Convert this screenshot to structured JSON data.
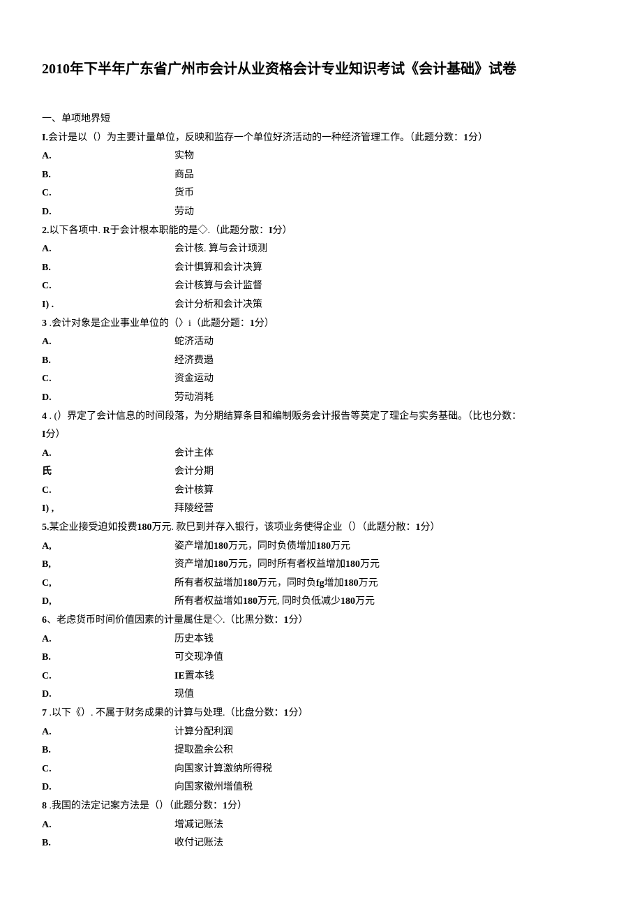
{
  "title": "2010年下半年广东省广州市会计从业资格会计专业知识考试《会计基础》试卷",
  "section1": "一、单项地界短",
  "questions": [
    {
      "num": "I.",
      "stem": "会计是以（）为主要计量单位，反映和监存一个单位好济活动的一种经济管理工作。（此题分数：",
      "tail": "分）",
      "tailnum": "1",
      "opts": [
        {
          "l": "A.",
          "t": "实物"
        },
        {
          "l": "B.",
          "t": "商品"
        },
        {
          "l": "C.",
          "t": "货币"
        },
        {
          "l": "D.",
          "t": "劳动"
        }
      ]
    },
    {
      "num": "2.",
      "stem": "以下各项中. ",
      "stembold": "R",
      "stem2": "于会计根本职能的是◇.（此题分散：",
      "tailnum": "I",
      "tail": "分）",
      "opts": [
        {
          "l": "A.",
          "t": "会计核. 算与会计顼测"
        },
        {
          "l": "B.",
          "t": "会计惧算和会计决算"
        },
        {
          "l": "C.",
          "t": "会计核算与会计监督"
        },
        {
          "l": "I) .",
          "t": "会计分析和会计决策"
        }
      ]
    },
    {
      "num": "3",
      "numsp": "   .",
      "stem": "会计对象是企业事业单位的（〉i（此题分题：",
      "tailnum": "1",
      "tail": "分）",
      "opts": [
        {
          "l": "A.",
          "t": "蛇济活动"
        },
        {
          "l": "B.",
          "t": "经济费遢"
        },
        {
          "l": "C.",
          "t": "资金运动"
        },
        {
          "l": "D.",
          "t": "劳动消耗"
        }
      ]
    },
    {
      "num": "4",
      "numsp": "   .  (",
      "stem": "）界定了会计信息的时间段落，为分期结算条目和编制贩务会计报告等莫定了理企与实务基础。（比也分数：",
      "tailnum": "I",
      "tail": "分）",
      "wrap": true,
      "opts": [
        {
          "l": "A.",
          "t": "会计主体"
        },
        {
          "l": "氏",
          "t": "会计分期"
        },
        {
          "l": "C.",
          "t": "会计核算"
        },
        {
          "l": "I) ,",
          "t": "拜陵经营"
        }
      ]
    },
    {
      "num": "5.",
      "stem": "某企业接受迫如投费",
      "stembold": "180",
      "stem2": "万元. 款巳到并存入银行，该项业务使得企业（）（此题分敝：",
      "tailnum": "1",
      "tail": "分）",
      "opts": [
        {
          "l": "A,",
          "t": "姿产增加",
          "t1b": "180",
          "t2": "万元，同时负债增加",
          "t3b": "180",
          "t4": "万元"
        },
        {
          "l": "B,",
          "t": "资产增加",
          "t1b": "180",
          "t2": "万元，同时所有者权益增加",
          "t3b": "180",
          "t4": "万元"
        },
        {
          "l": "C,",
          "t": "所有者权益增加",
          "t1b": "180",
          "t2": "万元，同时负",
          "t2b": "fg",
          "t2c": "增加",
          "t3b": "180",
          "t4": "万元"
        },
        {
          "l": "D,",
          "t": "所有者权益增如",
          "t1b": "180",
          "t2": "万元, 同时负低减少",
          "t3b": "180",
          "t4": "万元"
        }
      ]
    },
    {
      "num": "6",
      "numsp": "、",
      "stem": "老虑货币时间价值因素的计量属住是◇.（比黑分数：",
      "tailnum": "1",
      "tail": "分）",
      "opts": [
        {
          "l": "A.",
          "t": "历史本钱"
        },
        {
          "l": "B.",
          "t": "可交现净值"
        },
        {
          "l": "C.",
          "tbold": "IE",
          "t2": "置本钱"
        },
        {
          "l": "D.",
          "t": "现值"
        }
      ]
    },
    {
      "num": "7",
      "numsp": "   .",
      "stem": "以下《）. 不属于财务成果的计算与处理.（比盘分数：",
      "tailnum": "1",
      "tail": "分）",
      "opts": [
        {
          "l": "A.",
          "t": "计算分配利润"
        },
        {
          "l": "B.",
          "t": "提取盈余公积"
        },
        {
          "l": "C.",
          "t": "向国家计算激纳所得税"
        },
        {
          "l": "D.",
          "t": "向国家徽州增值税"
        }
      ]
    },
    {
      "num": "8",
      "numsp": "   .",
      "stem": "我国的法定记案方法是（）（此题分数：",
      "tailnum": "1",
      "tail": "分）",
      "opts": [
        {
          "l": "A.",
          "t": "增减记账法"
        },
        {
          "l": "B.",
          "t": "收付记账法"
        }
      ]
    }
  ]
}
